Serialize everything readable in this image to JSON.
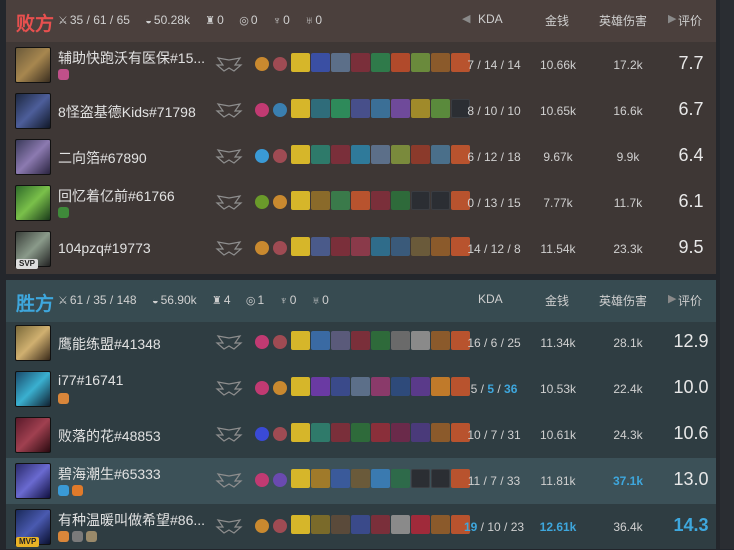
{
  "lose": {
    "title": "败方",
    "stats": {
      "kda": "35 / 61 / 65",
      "gold": "50.28k",
      "towers": "0",
      "inhibitors": "0",
      "dragons": "0",
      "barons": "0"
    },
    "cols": {
      "kda": "KDA",
      "gold": "金钱",
      "dmg": "英雄伤害",
      "score": "评价"
    },
    "players": [
      {
        "name": "辅助快跑沃有医保#15...",
        "kda": "7 / 14 / 14",
        "gold": "10.66k",
        "dmg": "17.2k",
        "score": "7.7"
      },
      {
        "name": "8怪盗基德Kids#71798",
        "kda": "8 / 10 / 10",
        "gold": "10.65k",
        "dmg": "16.6k",
        "score": "6.7"
      },
      {
        "name": "二向箔#67890",
        "kda": "6 / 12 / 18",
        "gold": "9.67k",
        "dmg": "9.9k",
        "score": "6.4"
      },
      {
        "name": "回忆着亿前#61766",
        "kda": "0 / 13 / 15",
        "gold": "7.77k",
        "dmg": "11.7k",
        "score": "6.1"
      },
      {
        "name": "104pzq#19773",
        "kda": "14 / 12 / 8",
        "gold": "11.54k",
        "dmg": "23.3k",
        "score": "9.5",
        "badge": "SVP"
      }
    ]
  },
  "win": {
    "title": "胜方",
    "stats": {
      "kda": "61 / 35 / 148",
      "gold": "56.90k",
      "towers": "4",
      "inhibitors": "1",
      "dragons": "0",
      "barons": "0"
    },
    "cols": {
      "kda": "KDA",
      "gold": "金钱",
      "dmg": "英雄伤害",
      "score": "评价"
    },
    "players": [
      {
        "name": "鹰能练盟#41348",
        "kda": "16 / 6 / 25",
        "gold": "11.34k",
        "dmg": "28.1k",
        "score": "12.9"
      },
      {
        "name": "i77#16741",
        "k": "5",
        "d": "5",
        "a": "36",
        "gold": "10.53k",
        "dmg": "22.4k",
        "score": "10.0"
      },
      {
        "name": "败落的花#48853",
        "kda": "10 / 7 / 31",
        "gold": "10.61k",
        "dmg": "24.3k",
        "score": "10.6"
      },
      {
        "name": "碧海潮生#65333",
        "kda": "11 / 7 / 33",
        "gold": "11.81k",
        "dmg": "37.1k",
        "score": "13.0"
      },
      {
        "name": "有种温暖叫做希望#86...",
        "k": "19",
        "d": "10",
        "a": "23",
        "gold": "12.61k",
        "dmg": "36.4k",
        "score": "14.3",
        "badge": "MVP"
      }
    ]
  },
  "colors": {
    "lose_accent": "#e8504f",
    "win_accent": "#3ea7dd"
  }
}
